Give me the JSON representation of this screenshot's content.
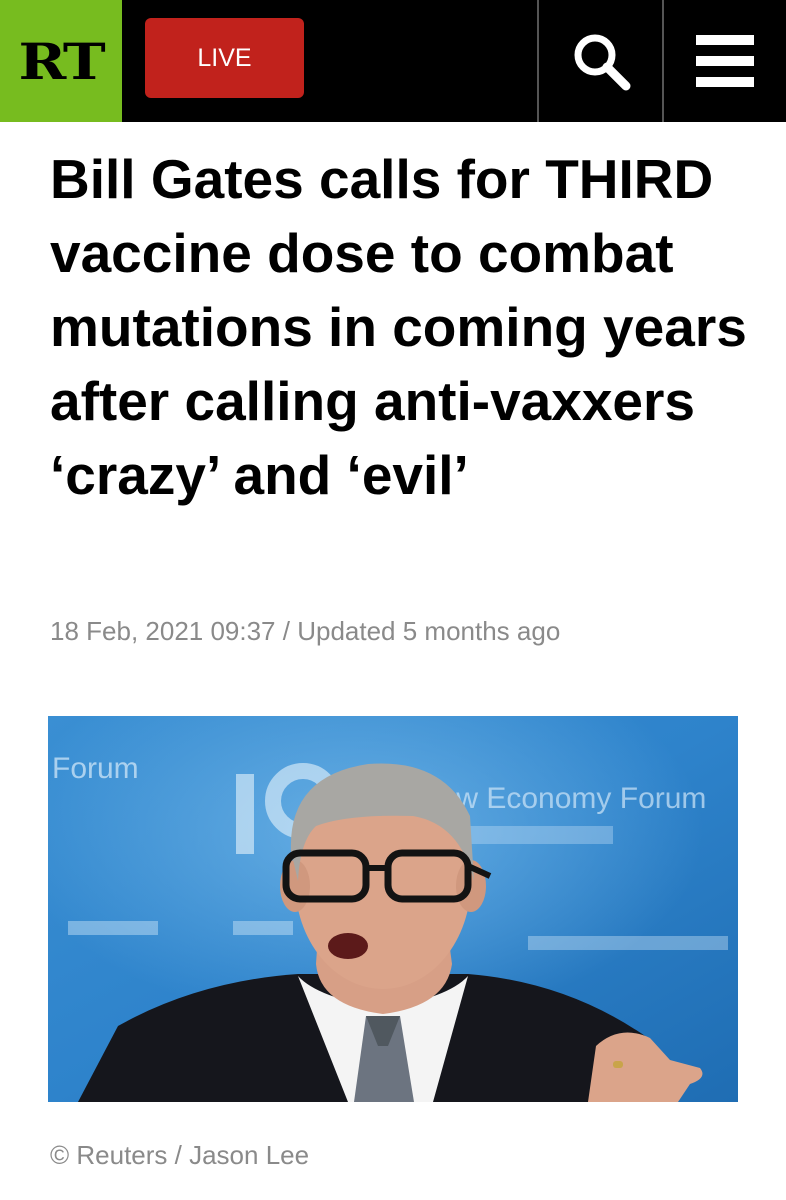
{
  "header": {
    "logo_text": "RT",
    "live_label": "LIVE"
  },
  "article": {
    "headline": "Bill Gates calls for THIRD vaccine dose to combat mutations in coming years after calling anti-vaxxers ‘crazy’ and ‘evil’",
    "date": "18 Feb, 2021 09:37",
    "separator": " / ",
    "updated": "Updated 5 months ago",
    "image_credit": "© Reuters / Jason Lee"
  },
  "photo": {
    "backdrop_text_1": "Forum",
    "backdrop_text_2": "New Economy Forum"
  },
  "colors": {
    "brand_green": "#77bc1f",
    "live_red": "#c1221c",
    "header_bg": "#000000",
    "meta_gray": "#8a8a8a"
  },
  "icons": {
    "search": "search-icon",
    "menu": "menu-icon"
  }
}
